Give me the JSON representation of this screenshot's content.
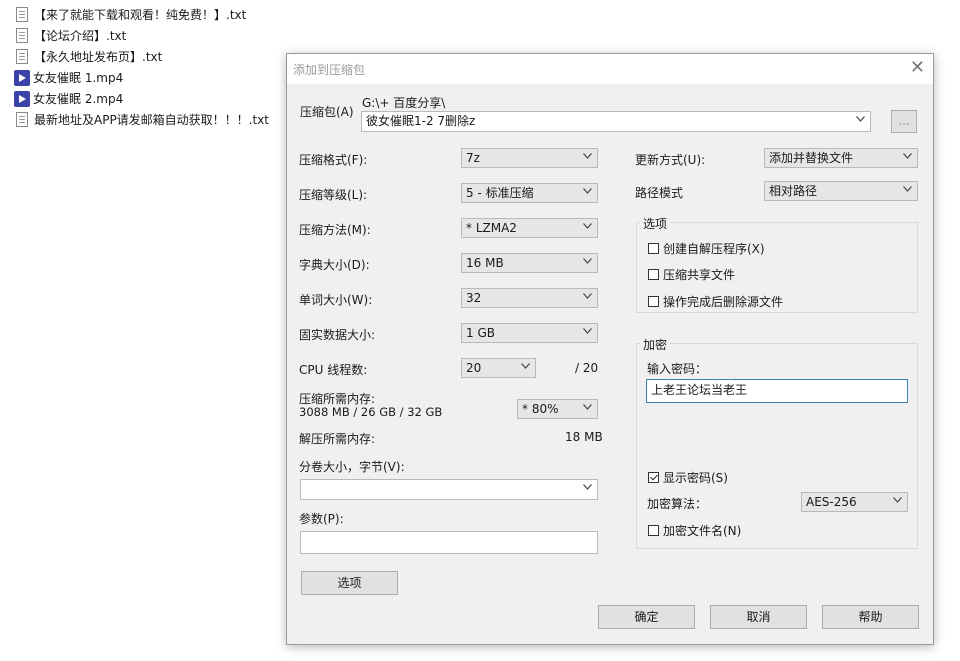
{
  "files": [
    {
      "name": "【来了就能下载和观看！纯免费！】.txt",
      "icon": "text-file-icon"
    },
    {
      "name": "【论坛介绍】.txt",
      "icon": "text-file-icon"
    },
    {
      "name": "【永久地址发布页】.txt",
      "icon": "text-file-icon"
    },
    {
      "name": "女友催眠 1.mp4",
      "icon": "video-file-icon"
    },
    {
      "name": "女友催眠 2.mp4",
      "icon": "video-file-icon"
    },
    {
      "name": "最新地址及APP请发邮箱自动获取！！！.txt",
      "icon": "text-file-icon"
    }
  ],
  "dialog": {
    "title": "添加到压缩包",
    "archive": {
      "label": "压缩包(A)",
      "path": "G:\\+ 百度分享\\",
      "name": "彼女催眠1-2 7删除z",
      "browse_label": "..."
    },
    "format": {
      "label": "压缩格式(F):",
      "value": "7z"
    },
    "level": {
      "label": "压缩等级(L):",
      "value": "5 - 标准压缩"
    },
    "method": {
      "label": "压缩方法(M):",
      "value": "* LZMA2"
    },
    "dict": {
      "label": "字典大小(D):",
      "value": "16 MB"
    },
    "word": {
      "label": "单词大小(W):",
      "value": "32"
    },
    "solid": {
      "label": "固实数据大小:",
      "value": "1 GB"
    },
    "threads": {
      "label": "CPU 线程数:",
      "value": "20",
      "max": "/ 20"
    },
    "mem_compress": {
      "label": "压缩所需内存:",
      "detail": "3088 MB / 26 GB / 32 GB",
      "value": "* 80%"
    },
    "mem_decompress": {
      "label": "解压所需内存:",
      "value": "18 MB"
    },
    "split": {
      "label": "分卷大小，字节(V):",
      "value": ""
    },
    "params": {
      "label": "参数(P):",
      "value": ""
    },
    "options_button": "选项",
    "update": {
      "label": "更新方式(U):",
      "value": "添加并替换文件"
    },
    "pathmode": {
      "label": "路径模式",
      "value": "相对路径"
    },
    "options": {
      "title": "选项",
      "sfx": "创建自解压程序(X)",
      "shared": "压缩共享文件",
      "delete": "操作完成后删除源文件"
    },
    "encrypt": {
      "title": "加密",
      "password_label": "输入密码：",
      "password": "上老王论坛当老王",
      "show_password": "显示密码(S)",
      "method_label": "加密算法：",
      "method": "AES-256",
      "encrypt_names": "加密文件名(N)"
    },
    "buttons": {
      "ok": "确定",
      "cancel": "取消",
      "help": "帮助"
    }
  }
}
